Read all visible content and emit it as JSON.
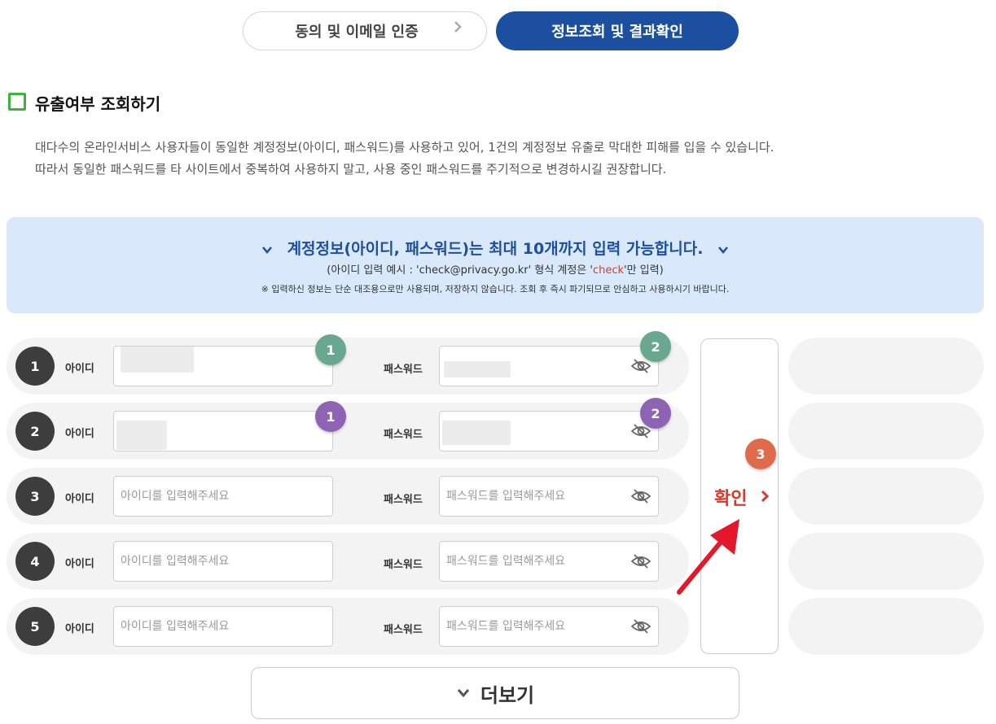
{
  "steps": {
    "step1": "동의 및 이메일 인증",
    "step2": "정보조회 및 결과확인"
  },
  "section": {
    "title": "유출여부 조회하기",
    "desc1": "대다수의 온라인서비스 사용자들이 동일한 계정정보(아이디, 패스워드)를 사용하고 있어, 1건의 계정정보 유출로 막대한 피해를 입을 수 있습니다.",
    "desc2": "따라서 동일한 패스워드를 타 사이트에서 중복하여 사용하지 말고, 사용 중인 패스워드를 주기적으로 변경하시길 권장합니다."
  },
  "banner": {
    "title": "계정정보(아이디, 패스워드)는 최대 10개까지 입력 가능합니다.",
    "example_pre": "(아이디 입력 예시 : 'check@privacy.go.kr' 형식 계정은 '",
    "example_highlight": "check",
    "example_post": "'만 입력)",
    "note": "※ 입력하신 정보는 단순 대조용으로만 사용되며, 저장하지 않습니다. 조회 후 즉시 파기되므로 안심하고 사용하시기 바랍니다."
  },
  "form": {
    "id_label": "아이디",
    "pw_label": "패스워드",
    "id_placeholder": "아이디를 입력해주세요",
    "pw_placeholder": "패스워드를 입력해주세요",
    "rows": [
      {
        "num": "1"
      },
      {
        "num": "2"
      },
      {
        "num": "3"
      },
      {
        "num": "4"
      },
      {
        "num": "5"
      }
    ]
  },
  "badges": {
    "id": "1",
    "pw": "2",
    "confirm": "3"
  },
  "confirm_label": "확인",
  "more_label": "더보기",
  "colors": {
    "primary": "#1d4fa0",
    "accent_red": "#d9392a",
    "badge_green": "#6aa790",
    "badge_purple": "#8e63b4",
    "badge_orange": "#e06a4c",
    "section_green": "#3ab53a"
  },
  "icons": [
    "chevron-right-icon",
    "chevron-down-icon",
    "eye-off-icon",
    "red-arrow-annotation"
  ]
}
